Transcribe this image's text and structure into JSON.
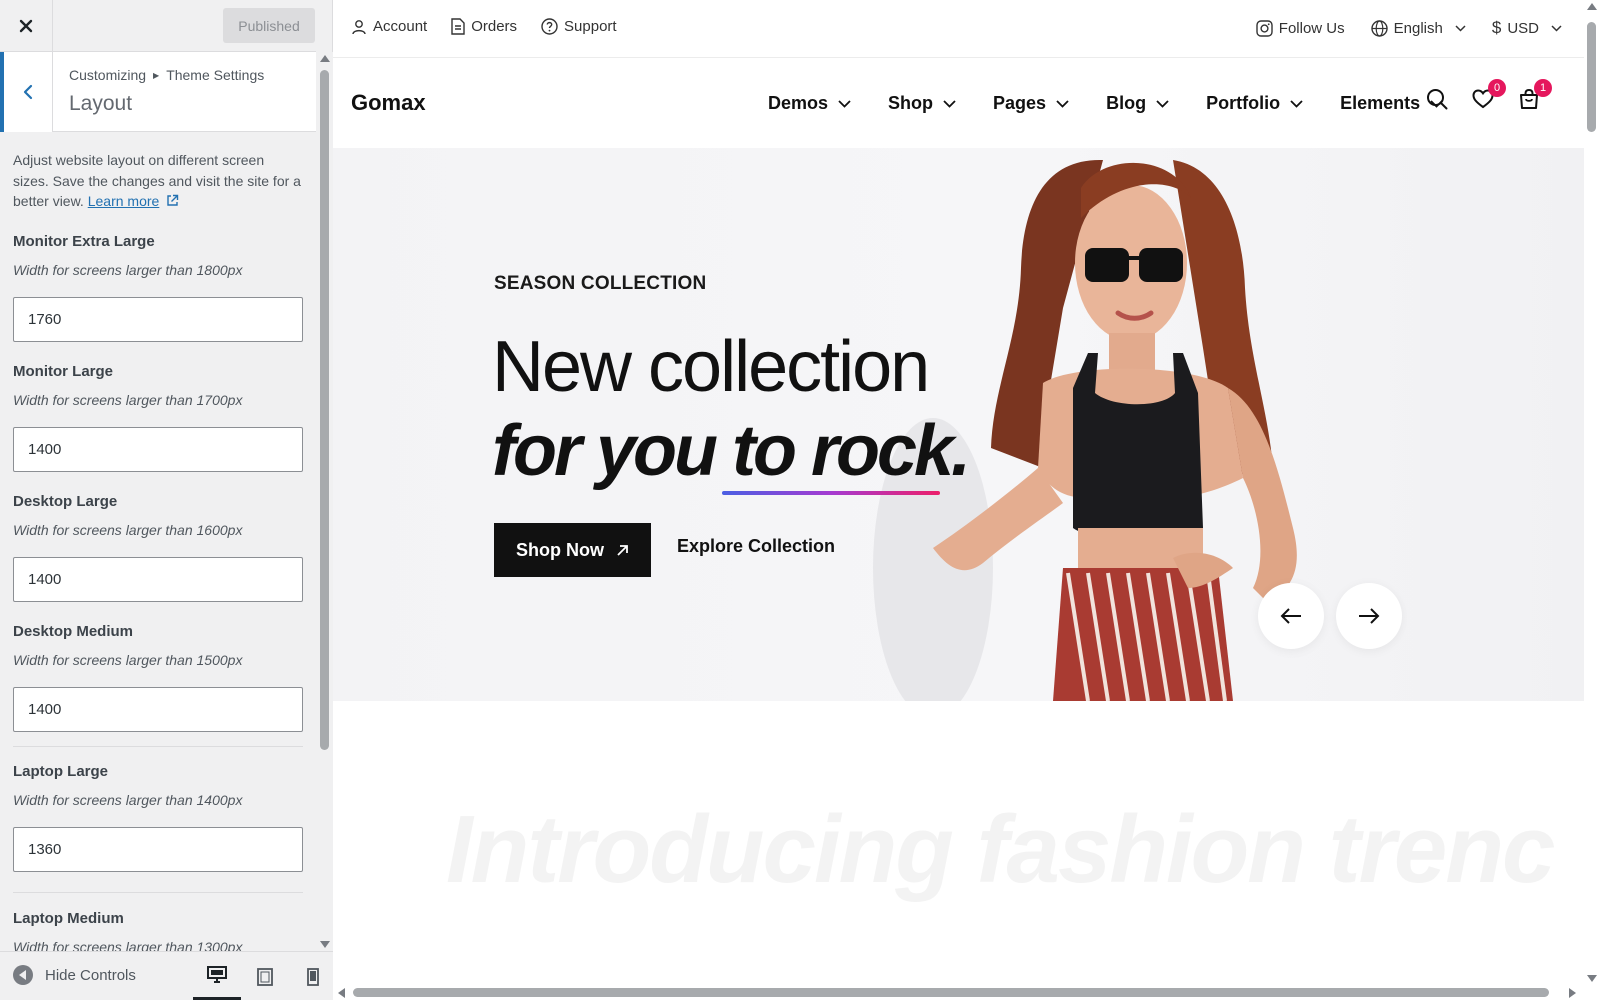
{
  "customizer": {
    "close_icon": "close-icon",
    "publish_label": "Published",
    "breadcrumb": [
      "Customizing",
      "Theme Settings"
    ],
    "section_title": "Layout",
    "description": "Adjust website layout on different screen sizes. Save the changes and visit the site for a better view.",
    "learn_more": "Learn more",
    "controls": [
      {
        "label": "Monitor Extra Large",
        "hint": "Width for screens larger than 1800px",
        "value": "1760"
      },
      {
        "label": "Monitor Large",
        "hint": "Width for screens larger than 1700px",
        "value": "1400"
      },
      {
        "label": "Desktop Large",
        "hint": "Width for screens larger than 1600px",
        "value": "1400"
      },
      {
        "label": "Desktop Medium",
        "hint": "Width for screens larger than 1500px",
        "value": "1400"
      },
      {
        "label": "Laptop Large",
        "hint": "Width for screens larger than 1400px",
        "value": "1360"
      },
      {
        "label": "Laptop Medium",
        "hint": "Width for screens larger than 1300px",
        "value": ""
      }
    ],
    "footer": {
      "hide_controls": "Hide Controls",
      "devices": [
        "desktop",
        "tablet",
        "mobile"
      ],
      "active_device": "desktop"
    },
    "accent_color": "#2271b1"
  },
  "preview": {
    "topbar": {
      "left": [
        "Account",
        "Orders",
        "Support"
      ],
      "follow": "Follow Us",
      "language": "English",
      "currency": "USD"
    },
    "logo": "Gomax",
    "menu": [
      "Demos",
      "Shop",
      "Pages",
      "Blog",
      "Portfolio",
      "Elements"
    ],
    "wishlist_count": "0",
    "cart_count": "1",
    "badge_color": "#e5175d",
    "hero": {
      "subtitle": "SEASON COLLECTION",
      "title_line1": "New collection",
      "title_line2": "for you to rock.",
      "primary_button": "Shop Now",
      "secondary_button": "Explore Collection"
    },
    "ghost_heading": "Introducing fashion trenc"
  }
}
